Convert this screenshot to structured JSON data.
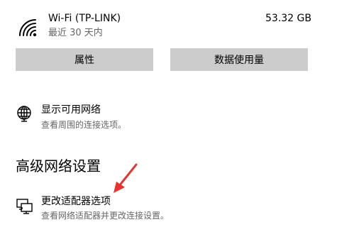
{
  "network_usage": {
    "name": "Wi-Fi (TP-LINK)",
    "period": "最近 30 天内",
    "amount": "53.32 GB"
  },
  "buttons": {
    "properties": "属性",
    "data_usage": "数据使用量"
  },
  "show_networks": {
    "title": "显示可用网络",
    "description": "查看周围的连接选项。"
  },
  "advanced": {
    "heading": "高级网络设置",
    "change_adapter": {
      "title": "更改适配器选项",
      "description": "查看网络适配器并更改连接设置。"
    }
  },
  "icons": {
    "wifi": "wifi-icon",
    "globe": "globe-icon",
    "adapter": "network-adapter-icon",
    "annotation": "red-arrow-icon"
  },
  "colors": {
    "button_bg": "#cccccc",
    "secondary_text": "#666666",
    "annotation_red": "#e8322b"
  }
}
